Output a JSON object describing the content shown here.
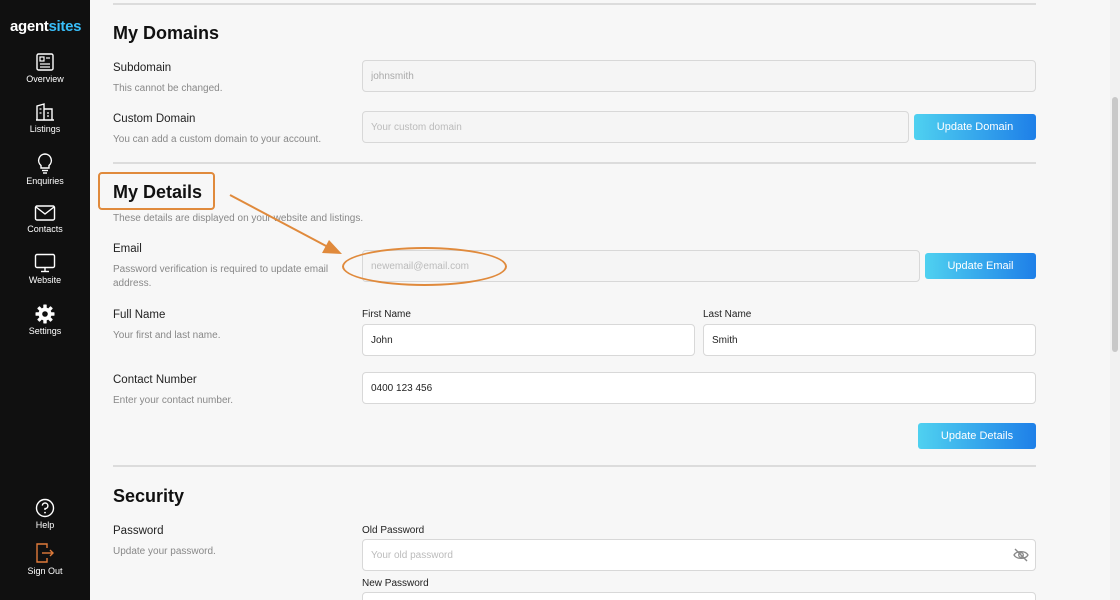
{
  "brand": {
    "part1": "agent",
    "part2": "sites"
  },
  "sidebar": {
    "items": [
      {
        "label": "Overview",
        "icon": "overview-icon"
      },
      {
        "label": "Listings",
        "icon": "listings-icon"
      },
      {
        "label": "Enquiries",
        "icon": "lightbulb-icon"
      },
      {
        "label": "Contacts",
        "icon": "envelope-icon"
      },
      {
        "label": "Website",
        "icon": "monitor-icon"
      },
      {
        "label": "Settings",
        "icon": "gear-icon"
      }
    ],
    "bottom": [
      {
        "label": "Help",
        "icon": "help-icon"
      },
      {
        "label": "Sign Out",
        "icon": "sign-out-icon"
      }
    ]
  },
  "domains": {
    "title": "My Domains",
    "subdomain": {
      "label": "Subdomain",
      "desc": "This cannot be changed.",
      "value": "johnsmith"
    },
    "custom": {
      "label": "Custom Domain",
      "desc": "You can add a custom domain to your account.",
      "placeholder": "Your custom domain",
      "button": "Update Domain"
    }
  },
  "details": {
    "title": "My Details",
    "desc": "These details are displayed on your website and listings.",
    "email": {
      "label": "Email",
      "desc": "Password verification is required to update email address.",
      "placeholder": "newemail@email.com",
      "button": "Update Email"
    },
    "full_name": {
      "label": "Full Name",
      "desc": "Your first and last name.",
      "first_label": "First Name",
      "first_value": "John",
      "last_label": "Last Name",
      "last_value": "Smith"
    },
    "contact": {
      "label": "Contact Number",
      "desc": "Enter your contact number.",
      "value": "0400 123 456"
    },
    "button": "Update Details"
  },
  "security": {
    "title": "Security",
    "password": {
      "label": "Password",
      "desc": "Update your password.",
      "old_label": "Old Password",
      "old_placeholder": "Your old password",
      "new_label": "New Password"
    }
  },
  "colors": {
    "accent_start": "#4fd1f0",
    "accent_end": "#1e7fe8",
    "annotation": "#e08a3c",
    "sidebar_bg": "#101010"
  }
}
